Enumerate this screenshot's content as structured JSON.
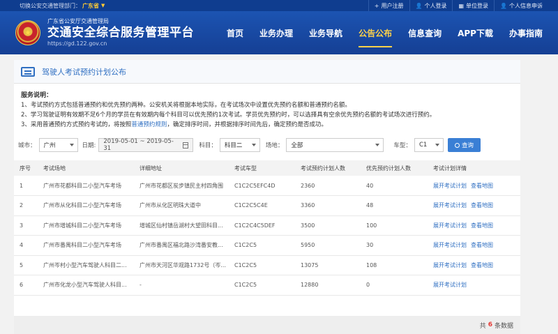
{
  "topbar": {
    "dept_label": "切换公安交通管理部门：",
    "dept_value": "广东省",
    "links": [
      {
        "icon": "user-plus-icon",
        "glyph": "+",
        "label": "用户注册"
      },
      {
        "icon": "person-icon",
        "glyph": "👤",
        "label": "个人登录"
      },
      {
        "icon": "org-icon",
        "glyph": "▦",
        "label": "单位登录"
      },
      {
        "icon": "person-icon",
        "glyph": "👤",
        "label": "个人信息申诉"
      }
    ]
  },
  "header": {
    "subtitle": "广东省公安厅交通管理局",
    "title": "交通安全综合服务管理平台",
    "url": "https://gd.122.gov.cn",
    "nav": [
      "首页",
      "业务办理",
      "业务导航",
      "公告公布",
      "信息查询",
      "APP下载",
      "办事指南"
    ],
    "active_nav": "公告公布"
  },
  "panel": {
    "title": "驾驶人考试预约计划公布",
    "notice_head": "服务说明：",
    "notice_lines": [
      "1、考试预约方式包括普通预约和优先预约两种。公安机关将根据本地实际，在考试场次中设置优先预约名额和普通预约名额。",
      "2、学习驾驶证明有效期不足6个月的学员在有效期内每个科目可以优先预约1次考试。学员优先预约时，可以选择具有空余优先预约名额的考试场次进行预约。"
    ],
    "notice_line3_a": "3、采用普通预约方式预约考试的，将按照",
    "notice_line3_link": "普通预约规则",
    "notice_line3_b": "，确定排序时间，并根据排序时间先后，确定预约是否成功。"
  },
  "filters": {
    "city_label": "城市：",
    "city_value": "广州",
    "date_label": "日期:",
    "date_value": "2019-05-01 ~ 2019-05-31",
    "subject_label": "科目：",
    "subject_value": "科目二",
    "site_label": "场地：",
    "site_value": "全部",
    "cartype_label": "车型：",
    "cartype_value": "C1",
    "query_label": "查询"
  },
  "table": {
    "headers": [
      "序号",
      "考试场地",
      "详细地址",
      "考试车型",
      "考试预约计划人数",
      "优先预约计划人数",
      "考试计划详情"
    ],
    "rows": [
      {
        "no": "1",
        "site": "广州市花都科目二小型汽车考场",
        "addr": "广州市花都区炭步镇民主村四角围",
        "type": "C1C2C5EFC4D",
        "plan": "2360",
        "prio": "40",
        "act1": "展开考试计划",
        "act2": "查看地图"
      },
      {
        "no": "2",
        "site": "广州市从化科目二小型汽车考场",
        "addr": "广州市从化区明珠大道中",
        "type": "C1C2C5C4E",
        "plan": "3360",
        "prio": "48",
        "act1": "展开考试计划",
        "act2": "查看地图"
      },
      {
        "no": "3",
        "site": "广州市增城科目二小型汽车考场",
        "addr": "增城区仙村镇岳湖村大望田科目...",
        "type": "C1C2C4C5DEF",
        "plan": "3500",
        "prio": "100",
        "act1": "展开考试计划",
        "act2": "查看地图"
      },
      {
        "no": "4",
        "site": "广州市番禺科目二小型汽车考场",
        "addr": "广州市番禺区福北路沙湾番安教...",
        "type": "C1C2C5",
        "plan": "5950",
        "prio": "30",
        "act1": "展开考试计划",
        "act2": "查看地图"
      },
      {
        "no": "5",
        "site": "广州岑村小型汽车驾驶人科目二...",
        "addr": "广州市天河区华观路1732号（岑...",
        "type": "C1C2C5",
        "plan": "13075",
        "prio": "108",
        "act1": "展开考试计划",
        "act2": "查看地图"
      },
      {
        "no": "6",
        "site": "广州市化龙小型汽车驾驶人科目...",
        "addr": "-",
        "type": "C1C2C5",
        "plan": "12880",
        "prio": "0",
        "act1": "展开考试计划",
        "act2": ""
      }
    ]
  },
  "footer": {
    "prefix": "共",
    "count": "6",
    "suffix": "条数据"
  }
}
